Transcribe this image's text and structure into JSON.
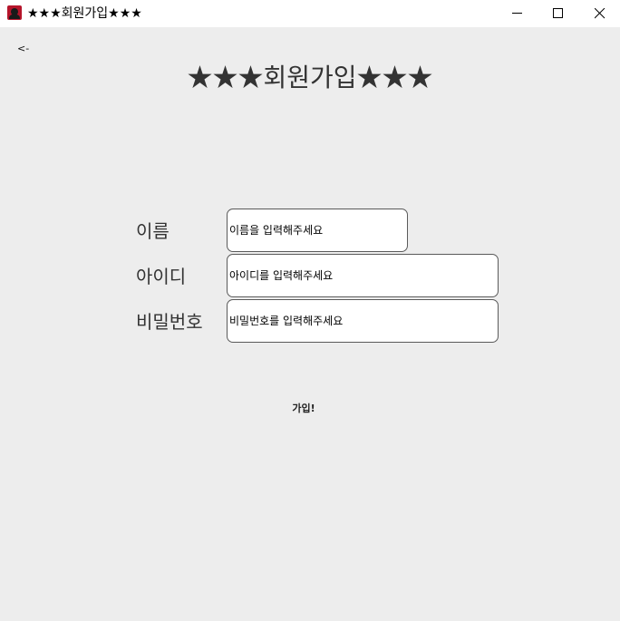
{
  "window": {
    "title": "★★★회원가입★★★",
    "icon": "app-icon",
    "controls": [
      "minimize-icon",
      "maximize-icon",
      "close-icon"
    ]
  },
  "nav": {
    "back_label": "<-"
  },
  "page": {
    "title": "★★★회원가입★★★"
  },
  "form": {
    "name": {
      "label": "이름",
      "value": "이름을 입력해주세요"
    },
    "id": {
      "label": "아이디",
      "value": "아이디를 입력해주세요"
    },
    "password": {
      "label": "비밀번호",
      "value": "비밀번호를 입력해주세요"
    },
    "submit_label": "가입!"
  },
  "colors": {
    "background": "#ededed",
    "titlebar": "#ffffff",
    "heading_text": "#333333",
    "input_border": "#5a5a5a",
    "icon_red": "#b5152b"
  }
}
